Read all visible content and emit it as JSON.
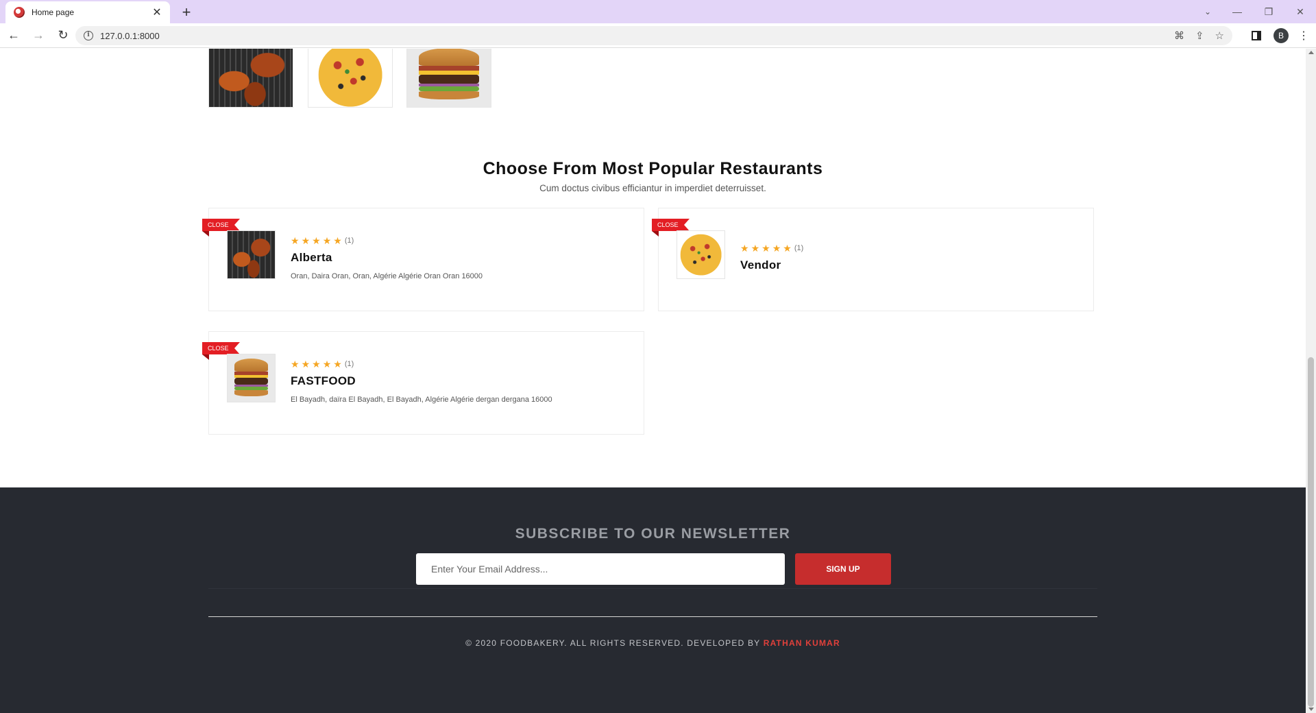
{
  "browser": {
    "tab_title": "Home page",
    "url": "127.0.0.1:8000",
    "profile_initial": "B"
  },
  "icons": {
    "back": "arrow-left-icon",
    "forward": "arrow-right-icon",
    "reload": "reload-icon",
    "info": "info-icon",
    "translate": "translate-icon",
    "share": "share-icon",
    "bookmark": "star-icon",
    "sidepanel": "side-panel-icon",
    "menu": "kebab-menu-icon"
  },
  "categories": [
    "chicken",
    "pizza",
    "burger"
  ],
  "section": {
    "title": "Choose From Most Popular Restaurants",
    "subtitle": "Cum doctus civibus efficiantur in imperdiet deterruisset."
  },
  "restaurants": [
    {
      "badge": "CLOSE",
      "image": "chicken",
      "stars": 5,
      "rating_count": "(1)",
      "name": "Alberta",
      "address": "Oran, Daira Oran, Oran, Algérie Algérie Oran Oran 16000"
    },
    {
      "badge": "CLOSE",
      "image": "pizza",
      "stars": 5,
      "rating_count": "(1)",
      "name": "Vendor",
      "address": ""
    },
    {
      "badge": "CLOSE",
      "image": "burger",
      "stars": 5,
      "rating_count": "(1)",
      "name": "FASTFOOD",
      "address": "El Bayadh, daïra El Bayadh, El Bayadh, Algérie Algérie dergan dergana 16000"
    }
  ],
  "newsletter": {
    "title": "SUBSCRIBE TO OUR NEWSLETTER",
    "email_placeholder": "Enter Your Email Address...",
    "email_value": "",
    "button_label": "SIGN UP"
  },
  "footer": {
    "copyright": "© 2020 FOODBAKERY. ALL RIGHTS RESERVED. DEVELOPED BY",
    "developer": "RATHAN KUMAR"
  },
  "colors": {
    "accent": "#e31e24",
    "footer_bg": "#272a31",
    "star": "#f5a623",
    "button": "#c62d2d"
  }
}
